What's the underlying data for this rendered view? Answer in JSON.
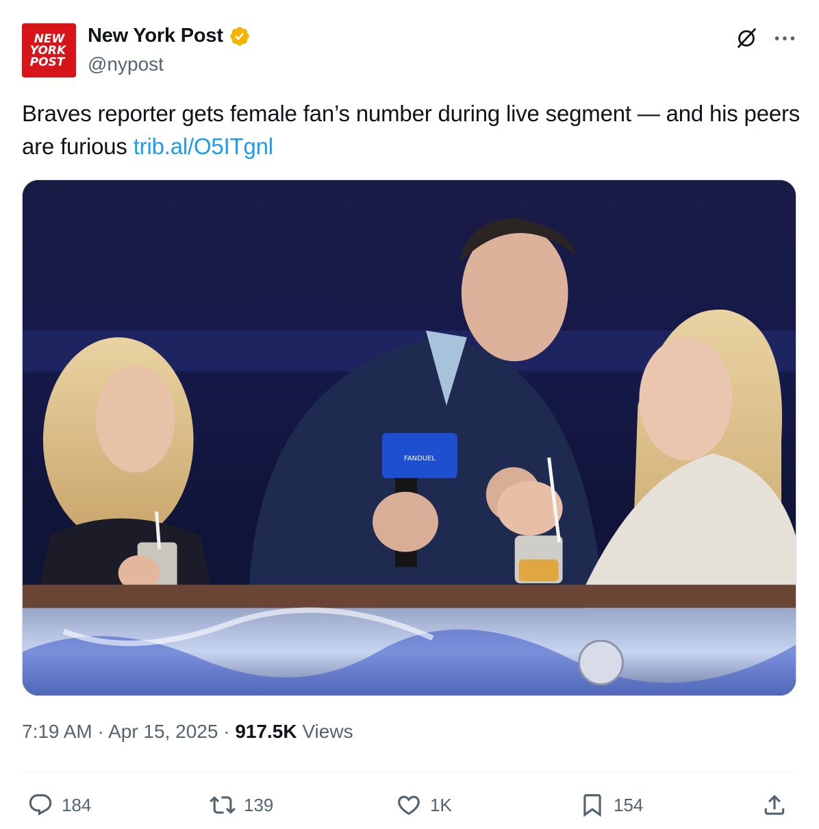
{
  "author": {
    "name": "New York Post",
    "handle": "@nypost",
    "logo_lines": [
      "NEW",
      "YORK",
      "POST"
    ]
  },
  "tweet": {
    "text": "Braves reporter gets female fan’s number during live segment — and his peers are furious ",
    "link": "trib.al/O5ITgnl"
  },
  "meta": {
    "time": "7:19 AM",
    "sep1": " · ",
    "date": "Apr 15, 2025",
    "sep2": " · ",
    "views_count": "917.5K",
    "views_label": " Views"
  },
  "actions": {
    "replies": "184",
    "reposts": "139",
    "likes": "1K",
    "bookmarks": "154"
  },
  "media": {
    "mic_flag_text": "FANDUEL"
  },
  "colors": {
    "brand_red": "#d7141a",
    "link_blue": "#1d9bf0",
    "muted": "#536471",
    "verified_gold": "#f4b400"
  }
}
